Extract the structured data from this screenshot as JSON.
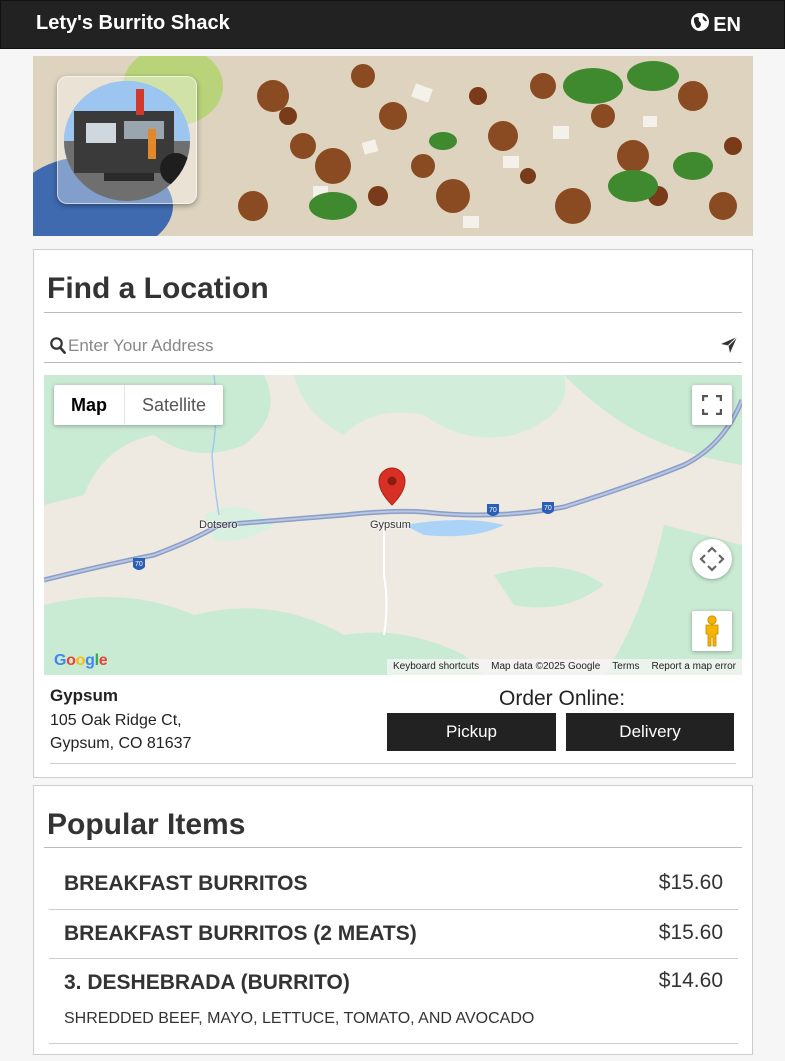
{
  "header": {
    "brand": "Lety's Burrito Shack",
    "language": "EN"
  },
  "find_location": {
    "title": "Find a Location",
    "search_placeholder": "Enter Your Address",
    "map": {
      "type_map": "Map",
      "type_satellite": "Satellite",
      "labels": {
        "town_1": "Dotsero",
        "town_2": "Gypsum",
        "shield_1": "70",
        "shield_2": "70",
        "shield_3": "70"
      },
      "google_logo": "Google",
      "footer": {
        "shortcuts": "Keyboard shortcuts",
        "data": "Map data ©2025 Google",
        "terms": "Terms",
        "report": "Report a map error"
      }
    },
    "location": {
      "name": "Gypsum",
      "address_line1": "105 Oak Ridge Ct,",
      "address_line2": "Gypsum, CO 81637"
    },
    "order_online_label": "Order Online:",
    "pickup_label": "Pickup",
    "delivery_label": "Delivery"
  },
  "popular": {
    "title": "Popular Items",
    "items": [
      {
        "name": "BREAKFAST BURRITOS",
        "price": "$15.60",
        "description": ""
      },
      {
        "name": "BREAKFAST BURRITOS (2 MEATS)",
        "price": "$15.60",
        "description": ""
      },
      {
        "name": "3. DESHEBRADA (BURRITO)",
        "price": "$14.60",
        "description": "SHREDDED BEEF, MAYO, LETTUCE, TOMATO, AND AVOCADO"
      }
    ]
  },
  "colors": {
    "header_bg": "#222222",
    "button_bg": "#222222",
    "map_pin": "#d93025",
    "map_park": "#c9ead3"
  }
}
